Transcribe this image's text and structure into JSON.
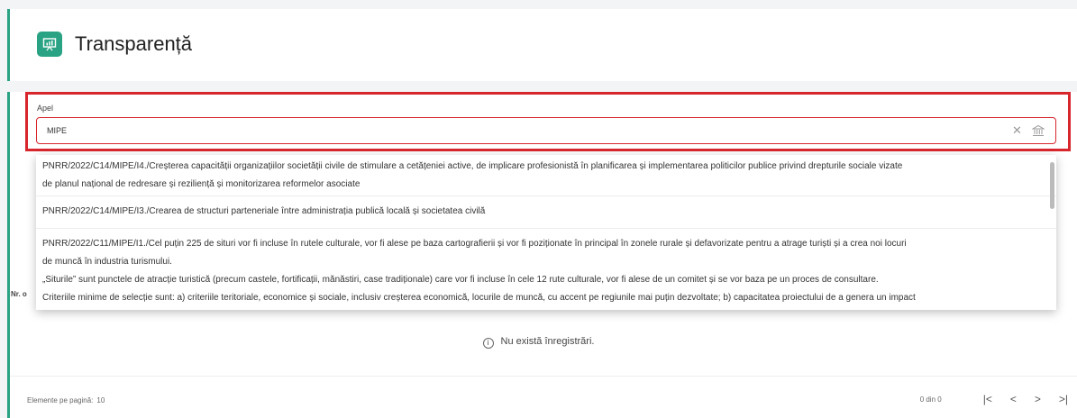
{
  "header": {
    "title": "Transparență",
    "icon": "presentation-icon",
    "accent": "#2aa384"
  },
  "filter": {
    "label": "Apel",
    "value": "MIPE",
    "highlight_color": "#d8262d"
  },
  "dropdown": {
    "options": [
      {
        "lines": [
          "PNRR/2022/C14/MIPE/I4./Creșterea capacității organizațiilor societății civile de stimulare a cetățeniei active, de implicare profesionistă în planificarea și implementarea politicilor publice privind drepturile sociale vizate",
          "de planul național de redresare și reziliență și monitorizarea reformelor asociate"
        ]
      },
      {
        "lines": [
          "PNRR/2022/C14/MIPE/I3./Crearea de structuri parteneriale între administrația publică locală și societatea civilă"
        ]
      },
      {
        "lines": [
          "PNRR/2022/C11/MIPE/I1./Cel puțin 225 de situri vor fi incluse în rutele culturale, vor fi alese pe baza cartografierii și vor fi poziționate în principal în zonele rurale și defavorizate pentru a atrage turiști și a crea noi locuri",
          "de muncă în industria turismului.",
          "„Siturile” sunt punctele de atracție turistică (precum castele, fortificații, mănăstiri, case tradiționale) care vor fi incluse în cele 12 rute culturale, vor fi alese de un comitet și se vor baza pe un proces de consultare.",
          "Criteriile minime de selecție sunt: a) criteriile teritoriale, economice și sociale, inclusiv creșterea economică, locurile de muncă, cu accent pe regiunile mai puțin dezvoltate; b) capacitatea proiectului de a genera un impact"
        ]
      }
    ]
  },
  "table": {
    "first_column_visible": "Nr. o",
    "empty_message": "Nu există înregistrări."
  },
  "footer": {
    "per_page_label": "Elemente pe pagină:",
    "per_page_value": "10",
    "range": "0 din 0",
    "first": "|<",
    "prev": "<",
    "next": ">",
    "last": ">|"
  }
}
